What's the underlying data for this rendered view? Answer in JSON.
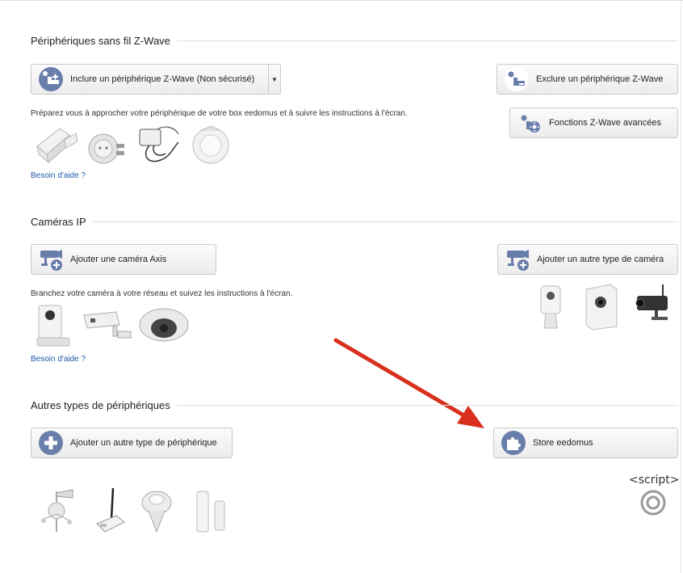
{
  "zwave": {
    "title": "Périphériques sans fil Z-Wave",
    "include_label": "Inclure un périphérique Z-Wave (Non sécurisé)",
    "exclude_label": "Exclure un périphérique Z-Wave",
    "advanced_label": "Fonctions Z-Wave avancées",
    "description": "Préparez vous à approcher votre périphérique de votre box eedomus et à suivre les instructions à l'écran.",
    "help": "Besoin d'aide ?",
    "device_icons": [
      "door-sensor-icon",
      "smart-plug-icon",
      "dimmer-module-icon",
      "motion-sensor-icon"
    ]
  },
  "cameras": {
    "title": "Caméras IP",
    "add_axis_label": "Ajouter une caméra Axis",
    "add_other_label": "Ajouter un autre type de caméra",
    "description": "Branchez votre caméra à votre réseau et suivez les instructions à l'écran.",
    "help": "Besoin d'aide ?",
    "device_icons": [
      "axis-cube-camera-icon",
      "axis-bullet-camera-icon",
      "axis-dome-camera-icon",
      "desk-camera-icon",
      "cube-camera-icon",
      "outdoor-camera-icon"
    ]
  },
  "others": {
    "title": "Autres types de périphériques",
    "add_other_label": "Ajouter un autre type de périphérique",
    "store_label": "Store eedomus",
    "device_icons": [
      "weather-station-icon",
      "usb-dongle-icon",
      "pool-sensor-icon",
      "netatmo-station-icon"
    ]
  },
  "script": {
    "label": "<script>"
  },
  "colors": {
    "icon_blue": "#6a7eab",
    "arrow_red": "#d8301c",
    "link_blue": "#1e5aa8"
  }
}
